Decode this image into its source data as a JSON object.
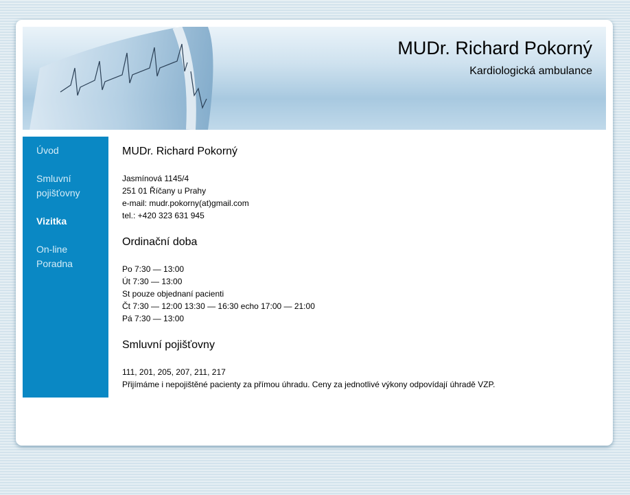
{
  "header": {
    "title": "MUDr. Richard Pokorný",
    "subtitle": "Kardiologická ambulance"
  },
  "nav": {
    "items": [
      {
        "label": "Úvod"
      },
      {
        "label": "Smluvní pojišťovny"
      },
      {
        "label": "Vizitka"
      },
      {
        "label": "On-line Poradna"
      }
    ]
  },
  "content": {
    "heading": "MUDr. Richard Pokorný",
    "address": [
      "Jasmínová 1145/4",
      "251 01 Říčany u Prahy",
      "e-mail: mudr.pokorny(at)gmail.com",
      "tel.: +420 323 631 945"
    ],
    "hours_heading": "Ordinační doba",
    "hours": [
      "Po 7:30 — 13:00",
      "Út 7:30 — 13:00",
      "St pouze objednaní pacienti",
      "Čt 7:30 — 12:00 13:30 — 16:30 echo 17:00 — 21:00",
      "Pá 7:30 — 13:00"
    ],
    "insurance_heading": "Smluvní pojišťovny",
    "insurance_codes": "111, 201, 205, 207, 211, 217",
    "insurance_note": "Přijímáme i nepojištěné pacienty za přímou úhradu. Ceny za jednotlivé výkony odpovídají úhradě VZP."
  },
  "colors": {
    "sidebar": "#0a88c4",
    "nav_text": "#d6edf8",
    "nav_active": "#ffffff"
  }
}
